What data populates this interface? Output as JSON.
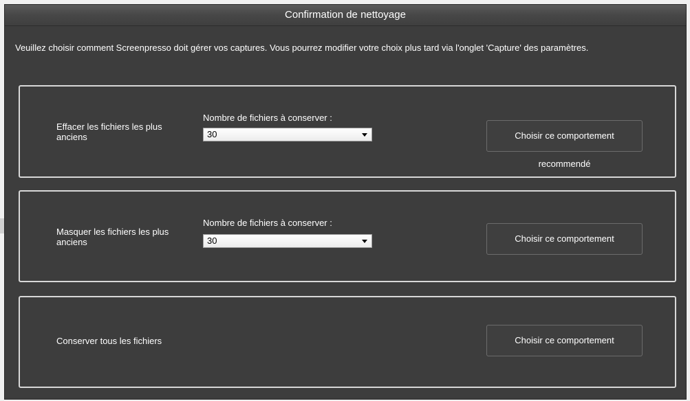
{
  "window": {
    "title": "Confirmation de nettoyage"
  },
  "intro": {
    "text": "Veuillez choisir comment Screenpresso doit gérer vos captures. Vous pourrez modifier votre choix plus tard via l'onglet 'Capture' des paramètres."
  },
  "options": [
    {
      "label": "Effacer les fichiers les plus anciens",
      "count_label": "Nombre de fichiers à conserver :",
      "count_value": "30",
      "button_label": "Choisir ce comportement",
      "note": "recommendé"
    },
    {
      "label": "Masquer les fichiers les plus anciens",
      "count_label": "Nombre de fichiers à conserver :",
      "count_value": "30",
      "button_label": "Choisir ce comportement"
    },
    {
      "label": "Conserver tous les fichiers",
      "button_label": "Choisir ce comportement"
    }
  ],
  "colors": {
    "window_bg": "#3d3d3d",
    "panel_border": "#d8d8d8",
    "text": "#ffffff"
  }
}
